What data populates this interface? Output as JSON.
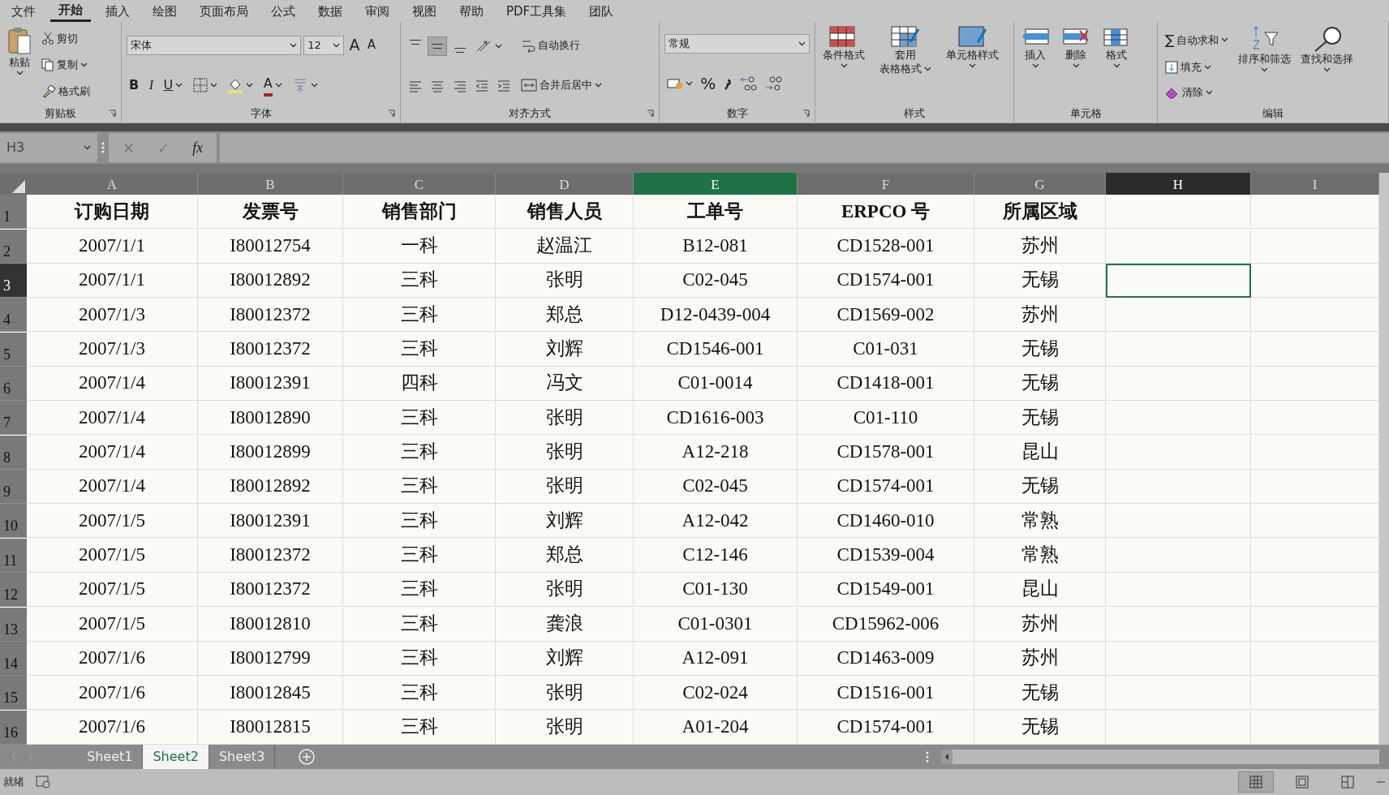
{
  "menu_tabs": [
    {
      "label": "文件",
      "selected": false
    },
    {
      "label": "开始",
      "selected": true
    },
    {
      "label": "插入",
      "selected": false
    },
    {
      "label": "绘图",
      "selected": false
    },
    {
      "label": "页面布局",
      "selected": false
    },
    {
      "label": "公式",
      "selected": false
    },
    {
      "label": "数据",
      "selected": false
    },
    {
      "label": "审阅",
      "selected": false
    },
    {
      "label": "视图",
      "selected": false
    },
    {
      "label": "帮助",
      "selected": false
    },
    {
      "label": "PDF工具集",
      "selected": false
    },
    {
      "label": "团队",
      "selected": false
    }
  ],
  "ribbon": {
    "clipboard": {
      "title": "剪贴板",
      "paste": "粘贴",
      "cut": "剪切",
      "copy": "复制",
      "format_painter": "格式刷"
    },
    "font": {
      "title": "字体",
      "font_name": "宋体",
      "font_size": "12",
      "grow": "A",
      "shrink": "A",
      "bold": "B",
      "italic": "I",
      "underline": "U",
      "font_color": "A"
    },
    "alignment": {
      "title": "对齐方式",
      "vertical": [
        {
          "selected": false
        },
        {
          "selected": true
        },
        {
          "selected": false
        }
      ],
      "wrap_text": "自动换行",
      "merge_center": "合并后居中"
    },
    "number": {
      "title": "数字",
      "format": "常规",
      "percent": "%"
    },
    "styles": {
      "title": "样式",
      "buttons": [
        {
          "lines": [
            "条件格式"
          ]
        },
        {
          "lines": [
            "套用",
            "表格格式"
          ]
        },
        {
          "lines": [
            "单元格样式"
          ]
        }
      ]
    },
    "cells": {
      "title": "单元格",
      "buttons": [
        "插入",
        "删除",
        "格式"
      ]
    },
    "editing": {
      "title": "编辑",
      "autosum_symbol": "∑",
      "autosum": "自动求和",
      "fill": "填充",
      "clear": "清除",
      "sort_filter": "排序和筛选",
      "find_select": "查找和选择"
    }
  },
  "formula_bar": {
    "name_box": "H3",
    "cancel": "✕",
    "enter": "✓",
    "fx": "fx",
    "disabled": true
  },
  "columns": [
    {
      "letter": "A",
      "highlighted": false,
      "active": false
    },
    {
      "letter": "B",
      "highlighted": false,
      "active": false
    },
    {
      "letter": "C",
      "highlighted": false,
      "active": false
    },
    {
      "letter": "D",
      "highlighted": false,
      "active": false
    },
    {
      "letter": "E",
      "highlighted": true,
      "active": false
    },
    {
      "letter": "F",
      "highlighted": false,
      "active": false
    },
    {
      "letter": "G",
      "highlighted": false,
      "active": false
    },
    {
      "letter": "H",
      "highlighted": false,
      "active": true
    },
    {
      "letter": "I",
      "highlighted": false,
      "active": false
    }
  ],
  "rows": [
    {
      "number": "1",
      "active": false,
      "header": true,
      "cells": [
        "订购日期",
        "发票号",
        "销售部门",
        "销售人员",
        "工单号",
        "ERPCO 号",
        "所属区域"
      ]
    },
    {
      "number": "2",
      "active": false,
      "header": false,
      "cells": [
        "2007/1/1",
        "I80012754",
        "一科",
        "赵温江",
        "B12-081",
        "CD1528-001",
        "苏州"
      ]
    },
    {
      "number": "3",
      "active": true,
      "header": false,
      "cells": [
        "2007/1/1",
        "I80012892",
        "三科",
        "张明",
        "C02-045",
        "CD1574-001",
        "无锡"
      ]
    },
    {
      "number": "4",
      "active": false,
      "header": false,
      "cells": [
        "2007/1/3",
        "I80012372",
        "三科",
        "郑总",
        "D12-0439-004",
        "CD1569-002",
        "苏州"
      ]
    },
    {
      "number": "5",
      "active": false,
      "header": false,
      "cells": [
        "2007/1/3",
        "I80012372",
        "三科",
        "刘辉",
        "CD1546-001",
        "C01-031",
        "无锡"
      ]
    },
    {
      "number": "6",
      "active": false,
      "header": false,
      "cells": [
        "2007/1/4",
        "I80012391",
        "四科",
        "冯文",
        "C01-0014",
        "CD1418-001",
        "无锡"
      ]
    },
    {
      "number": "7",
      "active": false,
      "header": false,
      "cells": [
        "2007/1/4",
        "I80012890",
        "三科",
        "张明",
        "CD1616-003",
        "C01-110",
        "无锡"
      ]
    },
    {
      "number": "8",
      "active": false,
      "header": false,
      "cells": [
        "2007/1/4",
        "I80012899",
        "三科",
        "张明",
        "A12-218",
        "CD1578-001",
        "昆山"
      ]
    },
    {
      "number": "9",
      "active": false,
      "header": false,
      "cells": [
        "2007/1/4",
        "I80012892",
        "三科",
        "张明",
        "C02-045",
        "CD1574-001",
        "无锡"
      ]
    },
    {
      "number": "10",
      "active": false,
      "header": false,
      "cells": [
        "2007/1/5",
        "I80012391",
        "三科",
        "刘辉",
        "A12-042",
        "CD1460-010",
        "常熟"
      ]
    },
    {
      "number": "11",
      "active": false,
      "header": false,
      "cells": [
        "2007/1/5",
        "I80012372",
        "三科",
        "郑总",
        "C12-146",
        "CD1539-004",
        "常熟"
      ]
    },
    {
      "number": "12",
      "active": false,
      "header": false,
      "cells": [
        "2007/1/5",
        "I80012372",
        "三科",
        "张明",
        "C01-130",
        "CD1549-001",
        "昆山"
      ]
    },
    {
      "number": "13",
      "active": false,
      "header": false,
      "cells": [
        "2007/1/5",
        "I80012810",
        "三科",
        "龚浪",
        "C01-0301",
        "CD15962-006",
        "苏州"
      ]
    },
    {
      "number": "14",
      "active": false,
      "header": false,
      "cells": [
        "2007/1/6",
        "I80012799",
        "三科",
        "刘辉",
        "A12-091",
        "CD1463-009",
        "苏州"
      ]
    },
    {
      "number": "15",
      "active": false,
      "header": false,
      "cells": [
        "2007/1/6",
        "I80012845",
        "三科",
        "张明",
        "C02-024",
        "CD1516-001",
        "无锡"
      ]
    },
    {
      "number": "16",
      "active": false,
      "header": false,
      "cells": [
        "2007/1/6",
        "I80012815",
        "三科",
        "张明",
        "A01-204",
        "CD1574-001",
        "无锡"
      ]
    }
  ],
  "sheet_tabs": [
    {
      "label": "Sheet1",
      "selected": false
    },
    {
      "label": "Sheet2",
      "selected": true
    },
    {
      "label": "Sheet3",
      "selected": false
    }
  ],
  "status_bar": {
    "text": "就绪",
    "views": [
      {
        "selected": true
      },
      {
        "selected": false
      },
      {
        "selected": false
      }
    ]
  }
}
